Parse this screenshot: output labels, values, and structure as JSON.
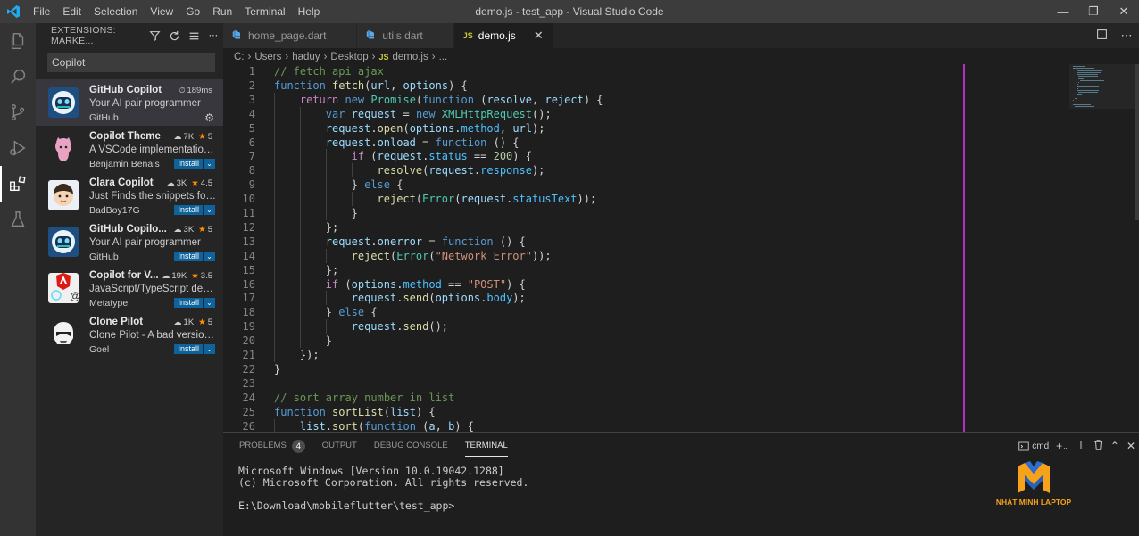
{
  "window": {
    "title": "demo.js - test_app - Visual Studio Code",
    "menus": [
      "File",
      "Edit",
      "Selection",
      "View",
      "Go",
      "Run",
      "Terminal",
      "Help"
    ]
  },
  "sidebar": {
    "header": "EXTENSIONS: MARKE...",
    "search_value": "Copilot",
    "extensions": [
      {
        "name": "GitHub Copilot",
        "stats": "189ms",
        "rating": "",
        "description": "Your AI pair programmer",
        "publisher": "GitHub",
        "action": "",
        "logo": "copilot"
      },
      {
        "name": "Copilot Theme",
        "stats": "7K",
        "rating": "5",
        "description": "A VSCode implementation ...",
        "publisher": "Benjamin Benais",
        "action": "Install",
        "logo": "octocat"
      },
      {
        "name": "Clara Copilot",
        "stats": "3K",
        "rating": "4.5",
        "description": "Just Finds the snippets for ...",
        "publisher": "BadBoy17G",
        "action": "Install",
        "logo": "clara"
      },
      {
        "name": "GitHub Copilo...",
        "stats": "3K",
        "rating": "5",
        "description": "Your AI pair programmer",
        "publisher": "GitHub",
        "action": "Install",
        "logo": "copilot"
      },
      {
        "name": "Copilot for V...",
        "stats": "19K",
        "rating": "3.5",
        "description": "JavaScript/TypeScript devel...",
        "publisher": "Metatype",
        "action": "Install",
        "logo": "angular"
      },
      {
        "name": "Clone Pilot",
        "stats": "1K",
        "rating": "5",
        "description": "Clone Pilot - A bad version ...",
        "publisher": "Goel",
        "action": "Install",
        "logo": "trooper"
      }
    ]
  },
  "tabs": [
    {
      "label": "home_page.dart",
      "icon": "dart-icon",
      "active": false
    },
    {
      "label": "utils.dart",
      "icon": "dart-icon",
      "active": false
    },
    {
      "label": "demo.js",
      "icon": "js-icon",
      "active": true
    }
  ],
  "breadcrumb": [
    "C:",
    "Users",
    "haduy",
    "Desktop",
    "demo.js",
    "..."
  ],
  "editor": {
    "lines": [
      {
        "n": "1",
        "indent": 0,
        "code": "// fetch api ajax"
      },
      {
        "n": "2",
        "indent": 0,
        "code": "function fetch(url, options) {"
      },
      {
        "n": "3",
        "indent": 1,
        "code": "return new Promise(function (resolve, reject) {"
      },
      {
        "n": "4",
        "indent": 2,
        "code": "var request = new XMLHttpRequest();"
      },
      {
        "n": "5",
        "indent": 2,
        "code": "request.open(options.method, url);"
      },
      {
        "n": "6",
        "indent": 2,
        "code": "request.onload = function () {"
      },
      {
        "n": "7",
        "indent": 3,
        "code": "if (request.status == 200) {"
      },
      {
        "n": "8",
        "indent": 4,
        "code": "resolve(request.response);"
      },
      {
        "n": "9",
        "indent": 3,
        "code": "} else {"
      },
      {
        "n": "10",
        "indent": 4,
        "code": "reject(Error(request.statusText));"
      },
      {
        "n": "11",
        "indent": 3,
        "code": "}"
      },
      {
        "n": "12",
        "indent": 2,
        "code": "};"
      },
      {
        "n": "13",
        "indent": 2,
        "code": "request.onerror = function () {"
      },
      {
        "n": "14",
        "indent": 3,
        "code": "reject(Error(\"Network Error\"));"
      },
      {
        "n": "15",
        "indent": 2,
        "code": "};"
      },
      {
        "n": "16",
        "indent": 2,
        "code": "if (options.method == \"POST\") {"
      },
      {
        "n": "17",
        "indent": 3,
        "code": "request.send(options.body);"
      },
      {
        "n": "18",
        "indent": 2,
        "code": "} else {"
      },
      {
        "n": "19",
        "indent": 3,
        "code": "request.send();"
      },
      {
        "n": "20",
        "indent": 2,
        "code": "}"
      },
      {
        "n": "21",
        "indent": 1,
        "code": "});"
      },
      {
        "n": "22",
        "indent": 0,
        "code": "}"
      },
      {
        "n": "23",
        "indent": 0,
        "code": ""
      },
      {
        "n": "24",
        "indent": 0,
        "code": "// sort array number in list"
      },
      {
        "n": "25",
        "indent": 0,
        "code": "function sortList(list) {"
      },
      {
        "n": "26",
        "indent": 1,
        "code": "list.sort(function (a, b) {"
      }
    ]
  },
  "panel": {
    "tabs": [
      {
        "label": "PROBLEMS",
        "badge": "4",
        "active": false
      },
      {
        "label": "OUTPUT",
        "badge": "",
        "active": false
      },
      {
        "label": "DEBUG CONSOLE",
        "badge": "",
        "active": false
      },
      {
        "label": "TERMINAL",
        "badge": "",
        "active": true
      }
    ],
    "shell": "cmd",
    "terminal_lines": [
      "Microsoft Windows [Version 10.0.19042.1288]",
      "(c) Microsoft Corporation. All rights reserved.",
      "",
      "E:\\Download\\mobileflutter\\test_app>"
    ]
  },
  "watermark": "NHẬT MINH LAPTOP",
  "colors": {
    "accent": "#0e639c",
    "ruler": "#b82fb8",
    "star": "#ff8e00",
    "watermark": "#f7a21b"
  }
}
